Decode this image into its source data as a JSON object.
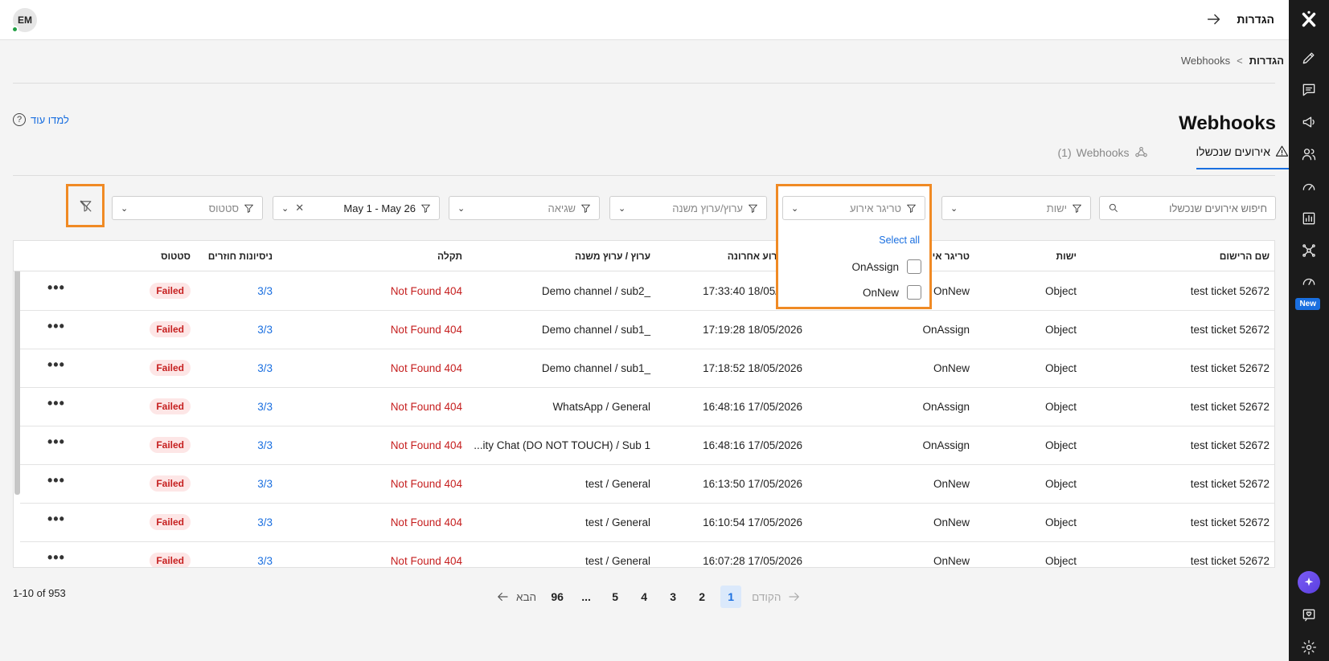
{
  "topbar": {
    "title": "הגדרות",
    "avatar_initials": "EM"
  },
  "breadcrumb": {
    "first": "הגדרות",
    "separator": ">",
    "second": "Webhooks"
  },
  "page": {
    "title": "Webhooks",
    "learn_more": "למדו עוד"
  },
  "tabs": [
    {
      "label": "אירועים שנכשלו",
      "active": true
    },
    {
      "label": "Webhooks",
      "count": "(1)",
      "active": false
    }
  ],
  "filters": {
    "search_placeholder": "חיפוש אירועים שנכשלו",
    "entity": "ישות",
    "trigger": "טריגר אירוע",
    "channel": "ערוץ/ערוץ משנה",
    "error": "שגיאה",
    "date_range": "May 1 - May 26",
    "status": "סטטוס"
  },
  "trigger_dropdown": {
    "select_all": "Select all",
    "options": [
      "OnAssign",
      "OnNew"
    ]
  },
  "table": {
    "headers": {
      "name": "שם הרישום",
      "entity": "ישות",
      "trigger": "טריגר אירוע",
      "time": "זמן אירוע אחרונה",
      "channel": "ערוץ / ערוץ משנה",
      "error": "תקלה",
      "retries": "ניסיונות חוזרים",
      "status": "סטטוס"
    },
    "rows": [
      {
        "name": "test ticket 52672",
        "entity": "Object",
        "trigger": "OnNew",
        "time": "17:33:40 18/05/2026",
        "channel": "Demo channel / sub2_",
        "error": "Not Found 404",
        "retries": "3/3",
        "status": "Failed"
      },
      {
        "name": "test ticket 52672",
        "entity": "Object",
        "trigger": "OnAssign",
        "time": "17:19:28 18/05/2026",
        "channel": "Demo channel / sub1_",
        "error": "Not Found 404",
        "retries": "3/3",
        "status": "Failed"
      },
      {
        "name": "test ticket 52672",
        "entity": "Object",
        "trigger": "OnNew",
        "time": "17:18:52 18/05/2026",
        "channel": "Demo channel / sub1_",
        "error": "Not Found 404",
        "retries": "3/3",
        "status": "Failed"
      },
      {
        "name": "test ticket 52672",
        "entity": "Object",
        "trigger": "OnAssign",
        "time": "16:48:16 17/05/2026",
        "channel": "WhatsApp / General",
        "error": "Not Found 404",
        "retries": "3/3",
        "status": "Failed"
      },
      {
        "name": "test ticket 52672",
        "entity": "Object",
        "trigger": "OnAssign",
        "time": "16:48:16 17/05/2026",
        "channel": "...ity Chat (DO NOT TOUCH) / Sub 1",
        "error": "Not Found 404",
        "retries": "3/3",
        "status": "Failed"
      },
      {
        "name": "test ticket 52672",
        "entity": "Object",
        "trigger": "OnNew",
        "time": "16:13:50 17/05/2026",
        "channel": "test / General",
        "error": "Not Found 404",
        "retries": "3/3",
        "status": "Failed"
      },
      {
        "name": "test ticket 52672",
        "entity": "Object",
        "trigger": "OnNew",
        "time": "16:10:54 17/05/2026",
        "channel": "test / General",
        "error": "Not Found 404",
        "retries": "3/3",
        "status": "Failed"
      },
      {
        "name": "test ticket 52672",
        "entity": "Object",
        "trigger": "OnNew",
        "time": "16:07:28 17/05/2026",
        "channel": "test / General",
        "error": "Not Found 404",
        "retries": "3/3",
        "status": "Failed"
      }
    ]
  },
  "pagination": {
    "summary": "1-10 of 953",
    "prev": "הקודם",
    "next": "הבא",
    "pages": [
      "1",
      "2",
      "3",
      "4",
      "5",
      "...",
      "96"
    ],
    "current": "1"
  },
  "sidebar": {
    "items": [
      "logo-icon",
      "edit-icon",
      "chat-icon",
      "megaphone-icon",
      "users-icon",
      "gauge-icon",
      "bar-chart-icon",
      "network-icon",
      "dashboard-icon",
      "ai-sparkle-icon",
      "heart-message-icon",
      "settings-icon"
    ],
    "new_badge": "New"
  },
  "colors": {
    "accent": "#1a6fe0",
    "highlight": "#f08a24",
    "error": "#c62020",
    "sidebar": "#1b1b1b"
  }
}
